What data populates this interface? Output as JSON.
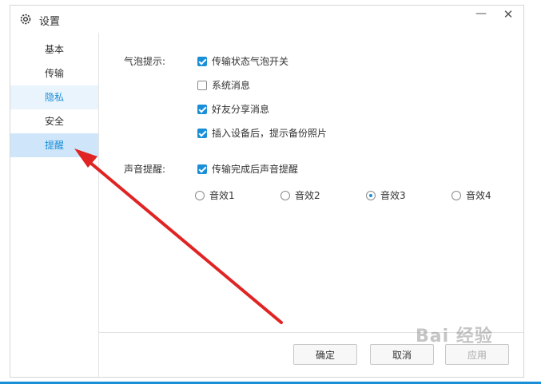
{
  "window": {
    "title": "设置"
  },
  "sidebar": {
    "items": [
      {
        "label": "基本"
      },
      {
        "label": "传输"
      },
      {
        "label": "隐私"
      },
      {
        "label": "安全"
      },
      {
        "label": "提醒"
      }
    ]
  },
  "bubble": {
    "label": "气泡提示:",
    "options": [
      {
        "label": "传输状态气泡开关",
        "checked": true
      },
      {
        "label": "系统消息",
        "checked": false
      },
      {
        "label": "好友分享消息",
        "checked": true
      },
      {
        "label": "插入设备后，提示备份照片",
        "checked": true
      }
    ]
  },
  "sound": {
    "label": "声音提醒:",
    "option": {
      "label": "传输完成后声音提醒",
      "checked": true
    },
    "effects": [
      {
        "label": "音效1",
        "selected": false
      },
      {
        "label": "音效2",
        "selected": false
      },
      {
        "label": "音效3",
        "selected": true
      },
      {
        "label": "音效4",
        "selected": false
      }
    ]
  },
  "footer": {
    "ok": "确定",
    "cancel": "取消",
    "apply": "应用"
  },
  "colors": {
    "accent": "#1a8fd8",
    "arrow": "#e02424"
  },
  "watermark": "Bai 经验"
}
